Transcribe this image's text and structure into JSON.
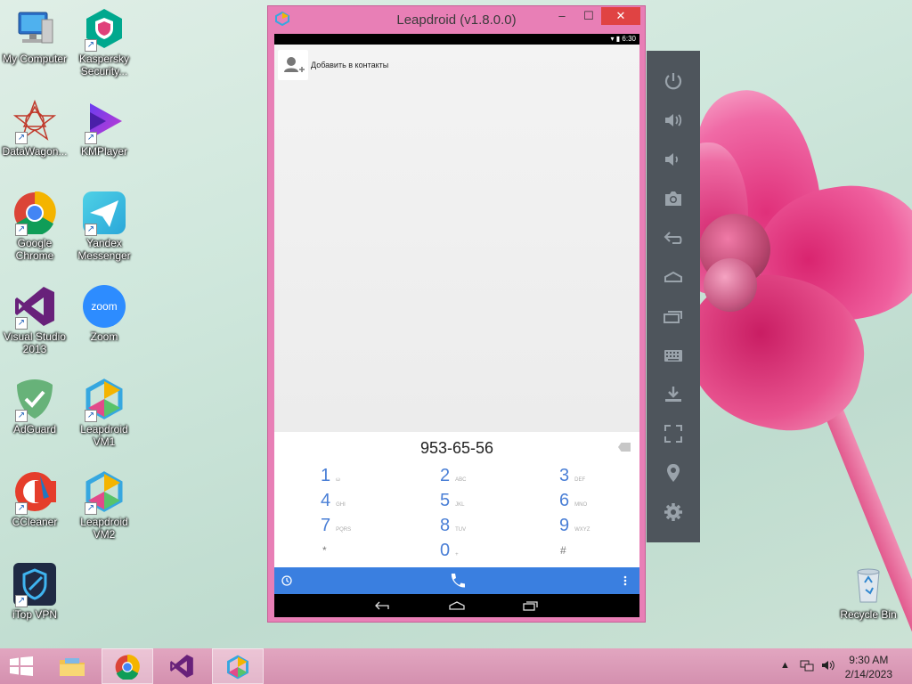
{
  "desktop": {
    "icons": [
      {
        "label": "My Computer"
      },
      {
        "label": "Kaspersky Security..."
      },
      {
        "label": "DataWagon..."
      },
      {
        "label": "KMPlayer"
      },
      {
        "label": "Google Chrome"
      },
      {
        "label": "Yandex Messenger"
      },
      {
        "label": "Visual Studio 2013"
      },
      {
        "label": "Zoom"
      },
      {
        "label": "AdGuard"
      },
      {
        "label": "Leapdroid VM1"
      },
      {
        "label": "CCleaner"
      },
      {
        "label": "Leapdroid VM2"
      },
      {
        "label": "iTop VPN"
      },
      {
        "label": "Recycle Bin"
      }
    ]
  },
  "emulator": {
    "title": "Leapdroid (v1.8.0.0)",
    "status_time": "6:30",
    "add_contact_label": "Добавить в контакты",
    "dialed_number": "953-65-56",
    "keys": [
      {
        "digit": "1",
        "letters": "ω"
      },
      {
        "digit": "2",
        "letters": "ABC"
      },
      {
        "digit": "3",
        "letters": "DEF"
      },
      {
        "digit": "4",
        "letters": "GHI"
      },
      {
        "digit": "5",
        "letters": "JKL"
      },
      {
        "digit": "6",
        "letters": "MNO"
      },
      {
        "digit": "7",
        "letters": "PQRS"
      },
      {
        "digit": "8",
        "letters": "TUV"
      },
      {
        "digit": "9",
        "letters": "WXYZ"
      },
      {
        "digit": "*",
        "letters": ""
      },
      {
        "digit": "0",
        "letters": "+"
      },
      {
        "digit": "#",
        "letters": ""
      }
    ],
    "toolbar_icons": [
      "power-icon",
      "volume-up-icon",
      "volume-down-icon",
      "camera-icon",
      "back-icon",
      "home-icon",
      "recents-icon",
      "keyboard-icon",
      "install-apk-icon",
      "fullscreen-icon",
      "location-icon",
      "settings-icon"
    ]
  },
  "taskbar": {
    "time": "9:30 AM",
    "date": "2/14/2023"
  },
  "colors": {
    "window_frame": "#e87fb6",
    "close_button": "#e04343",
    "dialer_accent": "#3a7fe0",
    "toolbar": "#4e555c",
    "taskbar": "#d490af"
  }
}
